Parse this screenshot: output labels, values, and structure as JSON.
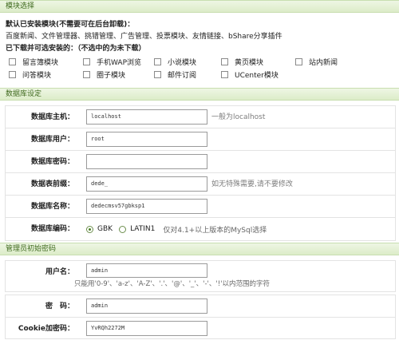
{
  "sections": {
    "modules": "模块选择",
    "database": "数据库设定",
    "admin": "管理员初始密码"
  },
  "intro": {
    "installed_title": "默认已安装模块(不需要可在后台卸载)：",
    "installed_list": "百度新闻、文件管理器、挑错管理、广告管理、投票模块、友情链接、bShare分享插件",
    "optional_title": "已下载并可选安装的：（不选中的为未下载）"
  },
  "modules": [
    {
      "label": "留言簿模块",
      "checked": false
    },
    {
      "label": "手机WAP浏览",
      "checked": false
    },
    {
      "label": "小说模块",
      "checked": false
    },
    {
      "label": "黄页模块",
      "checked": false
    },
    {
      "label": "站内新闻",
      "checked": false
    },
    {
      "label": "问答模块",
      "checked": false
    },
    {
      "label": "圈子模块",
      "checked": false
    },
    {
      "label": "邮件订阅",
      "checked": false
    },
    {
      "label": "UCenter模块",
      "checked": false
    }
  ],
  "db": {
    "host": {
      "label": "数据库主机：",
      "value": "localhost",
      "hint": "一般为localhost"
    },
    "user": {
      "label": "数据库用户：",
      "value": "root"
    },
    "password": {
      "label": "数据库密码：",
      "value": ""
    },
    "prefix": {
      "label": "数据表前缀：",
      "value": "dede_",
      "hint": "如无特殊需要,请不要修改"
    },
    "name": {
      "label": "数据库名称：",
      "value": "dedecmsv57gbksp1"
    },
    "charset": {
      "label": "数据库编码：",
      "options": [
        {
          "label": "GBK",
          "selected": true
        },
        {
          "label": "LATIN1",
          "selected": false
        }
      ],
      "note": "仅对4.1+以上版本的MySql选择"
    }
  },
  "admin": {
    "username": {
      "label": "用户名：",
      "value": "admin",
      "hint": "只能用'0-9'、'a-z'、'A-Z'、'.'、'@'、'_'、'-'、'!'以内范围的字符"
    },
    "password": {
      "label": "密　码：",
      "value": "admin"
    },
    "cookie": {
      "label": "Cookie加密码：",
      "value": "YvRQh2272M"
    }
  }
}
